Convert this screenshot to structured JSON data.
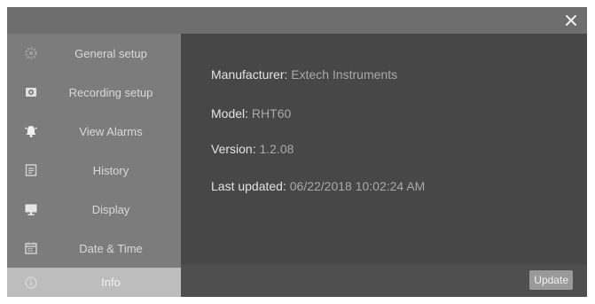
{
  "dialog": {
    "close_icon": "close-icon"
  },
  "sidebar": {
    "items": [
      {
        "label": "General setup",
        "icon": "gear-icon",
        "active": false
      },
      {
        "label": "Recording setup",
        "icon": "recording-gear-icon",
        "active": false
      },
      {
        "label": "View Alarms",
        "icon": "alarm-bell-icon",
        "active": false
      },
      {
        "label": "History",
        "icon": "history-icon",
        "active": false
      },
      {
        "label": "Display",
        "icon": "monitor-icon",
        "active": false
      },
      {
        "label": "Date & Time",
        "icon": "calendar-icon",
        "active": false
      },
      {
        "label": "Info",
        "icon": "info-icon",
        "active": true
      }
    ]
  },
  "info": {
    "manufacturer_label": "Manufacturer:",
    "manufacturer_value": "Extech Instruments",
    "model_label": "Model:",
    "model_value": "RHT60",
    "version_label": "Version:",
    "version_value": "1.2.08",
    "last_updated_label": "Last updated:",
    "last_updated_value": "06/22/2018  10:02:24 AM"
  },
  "footer": {
    "update_label": "Update"
  },
  "colors": {
    "sidebar_bg": "#7c7c7c",
    "active_item_bg": "#bdbdbd",
    "content_bg": "#474747",
    "titlebar_bg": "#6e6e6e"
  }
}
